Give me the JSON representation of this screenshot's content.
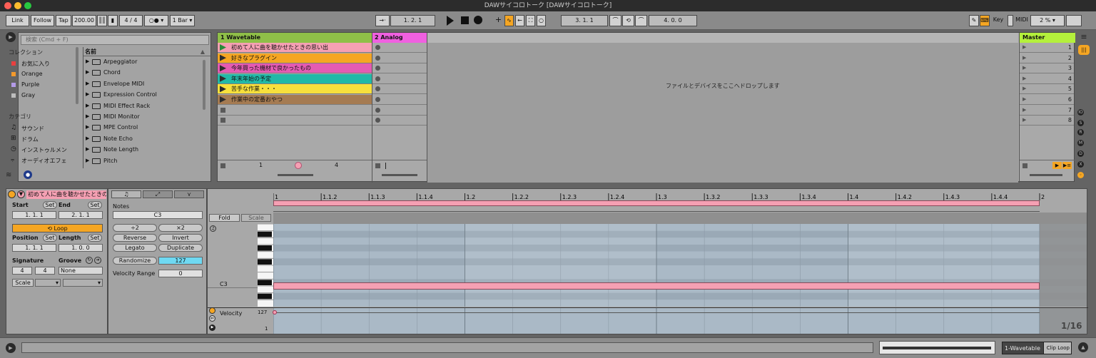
{
  "window": {
    "title": "DAWサイコロトーク  [DAWサイコロトーク]"
  },
  "control_bar": {
    "link": "Link",
    "follow": "Follow",
    "tap": "Tap",
    "tempo": "200.00",
    "signature": "4 / 4",
    "metronome": "○●",
    "quantize": "1 Bar",
    "position": "1.  2.  1",
    "loop_start": "3.  1.  1",
    "loop_length": "4.  0.  0",
    "key": "Key",
    "midi": "MIDI",
    "cpu": "2 %"
  },
  "browser": {
    "search_placeholder": "検索 (Cmd + F)",
    "collections_header": "コレクション",
    "collections": [
      {
        "label": "お気に入り",
        "color": "#e94040"
      },
      {
        "label": "Orange",
        "color": "#f39a2c"
      },
      {
        "label": "Purple",
        "color": "#b49be8"
      },
      {
        "label": "Gray",
        "color": "#bdbdbd"
      }
    ],
    "categories_header": "カテゴリ",
    "categories": [
      "サウンド",
      "ドラム",
      "インストゥルメン",
      "オーディオエフェ"
    ],
    "name_header": "名前",
    "items": [
      "Arpeggiator",
      "Chord",
      "Envelope MIDI",
      "Expression Control",
      "MIDI Effect Rack",
      "MIDI Monitor",
      "MPE Control",
      "Note Echo",
      "Note Length",
      "Pitch"
    ]
  },
  "session": {
    "tracks": [
      {
        "name": "1 Wavetable",
        "color": "#8fbf48",
        "clips": [
          {
            "label": "初めて人に曲を聴かせたときの思い出",
            "color": "#f5a0b3"
          },
          {
            "label": "好きなプラグイン",
            "color": "#f5a623"
          },
          {
            "label": "今年買った機材で良かったもの",
            "color": "#e45bb2"
          },
          {
            "label": "年末年始の予定",
            "color": "#21b9a7"
          },
          {
            "label": "苦手な作業・・・",
            "color": "#f7e03c"
          },
          {
            "label": "作業中の定番おやつ",
            "color": "#a57b52"
          }
        ],
        "footer_left": "1",
        "footer_right": "4"
      },
      {
        "name": "2 Analog",
        "color": "#f060e0"
      }
    ],
    "drop_hint": "ファイルとデバイスをここへドロップします",
    "master": {
      "name": "Master",
      "color": "#b4f03c",
      "scenes": [
        "1",
        "2",
        "3",
        "4",
        "5",
        "6",
        "7",
        "8"
      ]
    }
  },
  "clip_view": {
    "clip_name": "初めて人に曲を聴かせたときの",
    "start_label": "Start",
    "set": "Set",
    "end_label": "End",
    "start_value": "1.  1.  1",
    "end_value": "2.  1.  1",
    "loop": "Loop",
    "position_label": "Position",
    "length_label": "Length",
    "position_value": "1.  1.  1",
    "length_value": "1.  0.  0",
    "signature_label": "Signature",
    "groove_label": "Groove",
    "sig_num": "4",
    "sig_den": "4",
    "groove_value": "None",
    "scale": "Scale"
  },
  "notes_panel": {
    "header": "Notes",
    "note": "C3",
    "div2": "÷2",
    "mul2": "×2",
    "reverse": "Reverse",
    "invert": "Invert",
    "legato": "Legato",
    "duplicate": "Duplicate",
    "randomize": "Randomize",
    "rand_value": "127",
    "velocity_range": "Velocity Range",
    "vr_value": "0"
  },
  "editor": {
    "fold": "Fold",
    "scale": "Scale",
    "ruler": [
      "1",
      "1.1.2",
      "1.1.3",
      "1.1.4",
      "1.2",
      "1.2.2",
      "1.2.3",
      "1.2.4",
      "1.3",
      "1.3.2",
      "1.3.3",
      "1.3.4",
      "1.4",
      "1.4.2",
      "1.4.3",
      "1.4.4",
      "2"
    ],
    "note_label": "C3",
    "velocity_label": "Velocity",
    "vel_max": "127",
    "vel_min": "1",
    "grid": "1/16"
  },
  "status_bar": {
    "track": "1-Wavetable",
    "clip_loop": "Clip Loop"
  }
}
